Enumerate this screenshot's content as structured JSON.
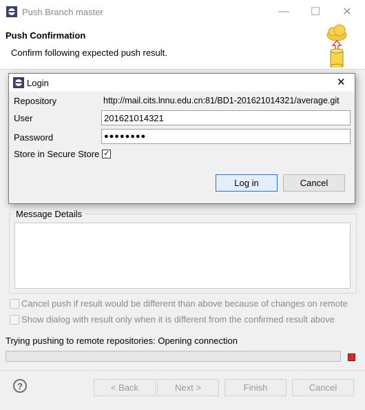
{
  "window": {
    "title": "Push Branch master",
    "header_title": "Push Confirmation",
    "header_subtitle": "Confirm following expected push result."
  },
  "message_details": {
    "legend": "Message Details"
  },
  "options": {
    "cancel_push": "Cancel push if result would be different than above because of changes on remote",
    "show_dialog": "Show dialog with result only when it is different from the confirmed result above"
  },
  "status": {
    "text": "Trying pushing to remote repositories: Opening connection",
    "progress": 0
  },
  "buttons": {
    "back": "< Back",
    "next": "Next >",
    "finish": "Finish",
    "cancel": "Cancel"
  },
  "login": {
    "title": "Login",
    "repository_label": "Repository",
    "repository_value": "http://mail.cits.lnnu.edu.cn:81/BD1-201621014321/average.git",
    "user_label": "User",
    "user_value": "201621014321",
    "password_label": "Password",
    "password_value": "●●●●●●●●",
    "store_label": "Store in Secure Store",
    "store_checked": true,
    "login_button": "Log in",
    "cancel_button": "Cancel"
  },
  "colors": {
    "stop_button": "#d9262b",
    "focus_border": "#2a6fd6"
  }
}
